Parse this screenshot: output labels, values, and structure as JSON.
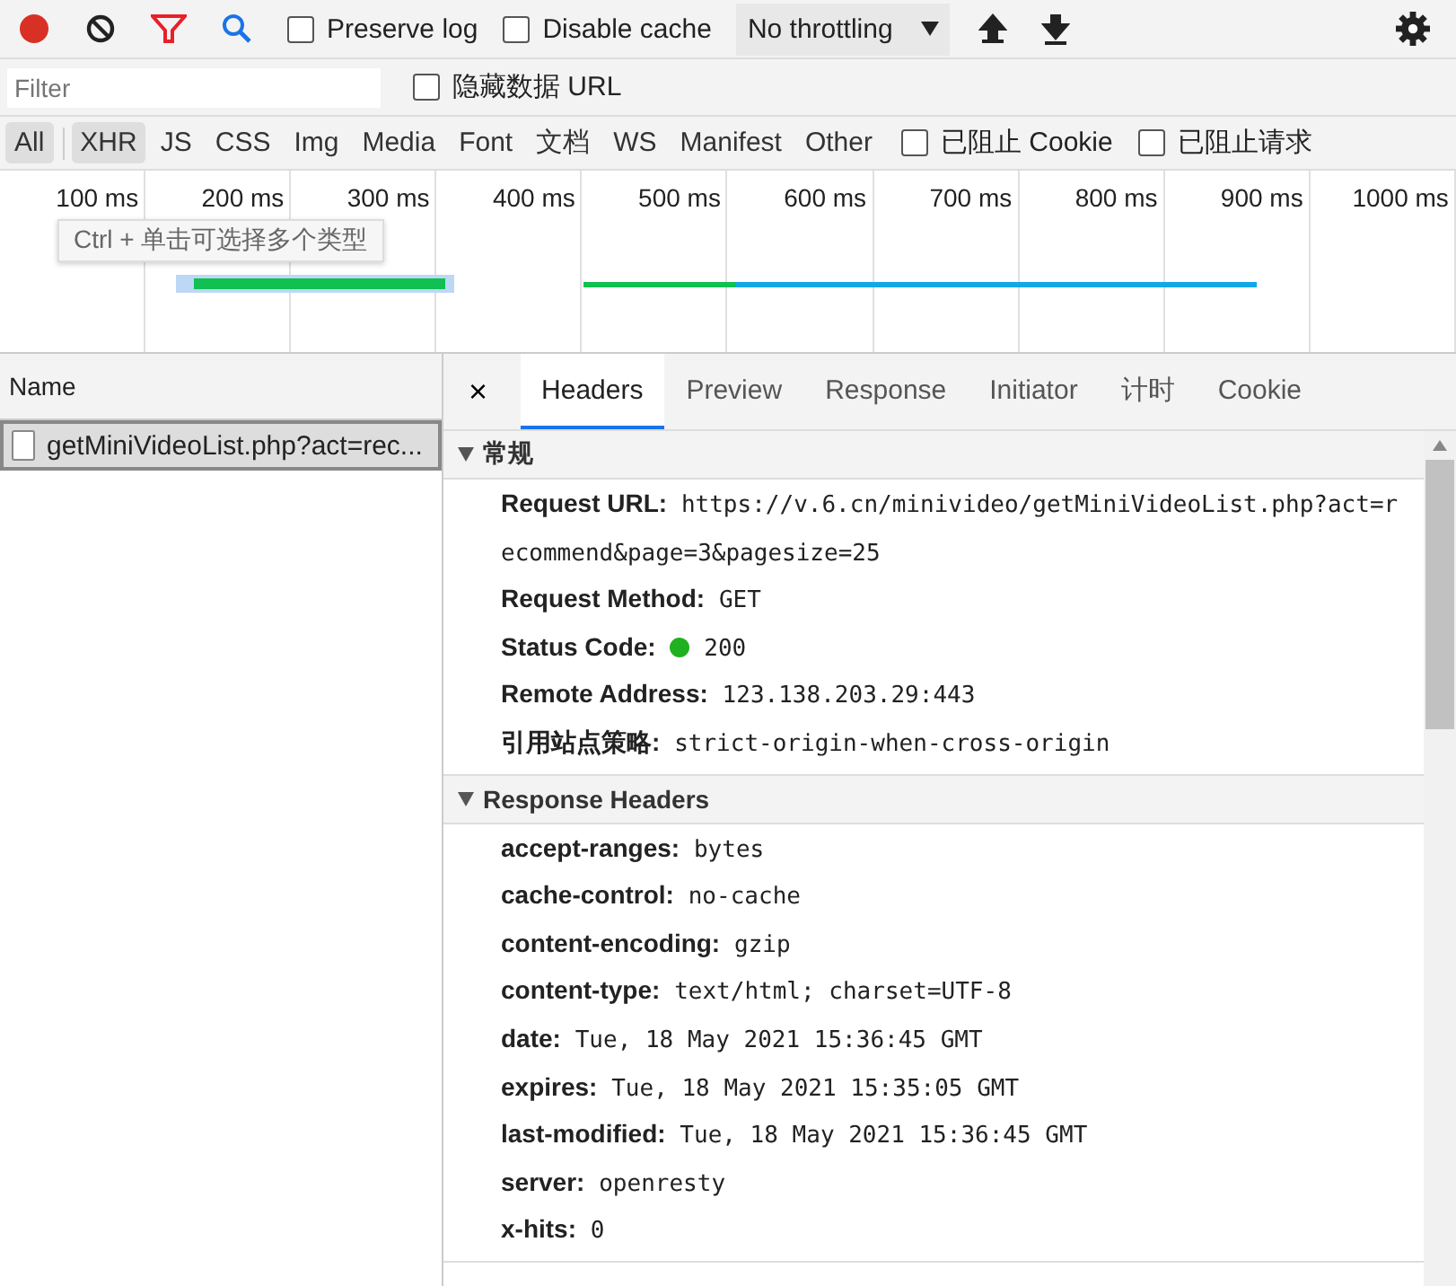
{
  "toolbar": {
    "preserve_log": {
      "label": "Preserve log",
      "checked": false
    },
    "disable_cache": {
      "label": "Disable cache",
      "checked": false
    },
    "throttling": {
      "value": "No throttling"
    }
  },
  "filter": {
    "placeholder": "Filter",
    "hide_data_urls": {
      "label": "隐藏数据 URL",
      "checked": false
    }
  },
  "type_filters": [
    {
      "label": "All",
      "selected": true
    },
    {
      "label": "XHR",
      "selected": true
    },
    {
      "label": "JS",
      "selected": false
    },
    {
      "label": "CSS",
      "selected": false
    },
    {
      "label": "Img",
      "selected": false
    },
    {
      "label": "Media",
      "selected": false
    },
    {
      "label": "Font",
      "selected": false
    },
    {
      "label": "文档",
      "selected": false
    },
    {
      "label": "WS",
      "selected": false
    },
    {
      "label": "Manifest",
      "selected": false
    },
    {
      "label": "Other",
      "selected": false
    }
  ],
  "blocked_cookies": {
    "label": "已阻止 Cookie",
    "checked": false
  },
  "blocked_requests": {
    "label": "已阻止请求",
    "checked": false
  },
  "overview": {
    "ticks": [
      "100 ms",
      "200 ms",
      "300 ms",
      "400 ms",
      "500 ms",
      "600 ms",
      "700 ms",
      "800 ms",
      "900 ms",
      "1000 ms"
    ],
    "tooltip": "Ctrl + 单击可选择多个类型"
  },
  "requests": {
    "column": "Name",
    "rows": [
      {
        "name": "getMiniVideoList.php?act=rec...",
        "selected": true
      }
    ]
  },
  "details": {
    "close": "×",
    "tabs": [
      {
        "label": "Headers",
        "selected": true
      },
      {
        "label": "Preview",
        "selected": false
      },
      {
        "label": "Response",
        "selected": false
      },
      {
        "label": "Initiator",
        "selected": false
      },
      {
        "label": "计时",
        "selected": false
      },
      {
        "label": "Cookie",
        "selected": false
      }
    ],
    "sections": [
      {
        "title": "常规",
        "expanded": true,
        "rows": [
          {
            "name": "Request URL:",
            "value": "https://v.6.cn/minivideo/getMiniVideoList.php?act=recommend&page=3&pagesize=25"
          },
          {
            "name": "Request Method:",
            "value": "GET"
          },
          {
            "name": "Status Code:",
            "value": "200",
            "kind": "status"
          },
          {
            "name": "Remote Address:",
            "value": "123.138.203.29:443"
          },
          {
            "name": "引用站点策略:",
            "value": "strict-origin-when-cross-origin"
          }
        ]
      },
      {
        "title": "Response Headers",
        "expanded": true,
        "rows": [
          {
            "name": "accept-ranges:",
            "value": "bytes"
          },
          {
            "name": "cache-control:",
            "value": "no-cache"
          },
          {
            "name": "content-encoding:",
            "value": "gzip"
          },
          {
            "name": "content-type:",
            "value": "text/html; charset=UTF-8"
          },
          {
            "name": "date:",
            "value": "Tue, 18 May 2021 15:36:45 GMT"
          },
          {
            "name": "expires:",
            "value": "Tue, 18 May 2021 15:35:05 GMT"
          },
          {
            "name": "last-modified:",
            "value": "Tue, 18 May 2021 15:36:45 GMT"
          },
          {
            "name": "server:",
            "value": "openresty"
          },
          {
            "name": "x-hits:",
            "value": "0"
          }
        ]
      }
    ]
  }
}
